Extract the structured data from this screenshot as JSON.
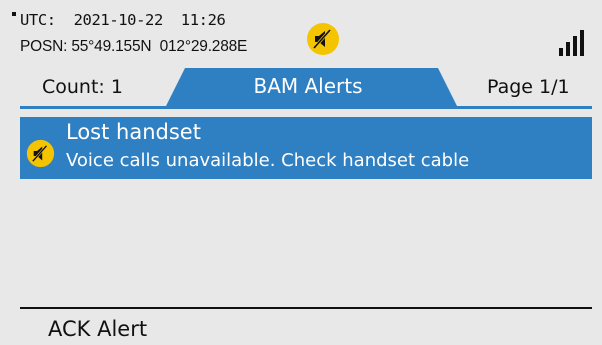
{
  "status": {
    "utc": "UTC:  2021-10-22  11:26",
    "position": "POSN: 55°49.155N  012°29.288E",
    "colors": {
      "alert_blue": "#2f7fc3",
      "icon_yellow": "#f5c400",
      "background": "#e8e8e8"
    },
    "icons": {
      "mute": "muted-speaker-icon",
      "signal": "signal-strength-icon"
    }
  },
  "tabs": {
    "count": "Count: 1",
    "title": "BAM Alerts",
    "page": "Page 1/1"
  },
  "alerts": [
    {
      "title": "Lost handset",
      "description": "Voice calls unavailable. Check handset cable",
      "icon": "muted-speaker-icon"
    }
  ],
  "softkeys": {
    "ack": "ACK Alert"
  }
}
